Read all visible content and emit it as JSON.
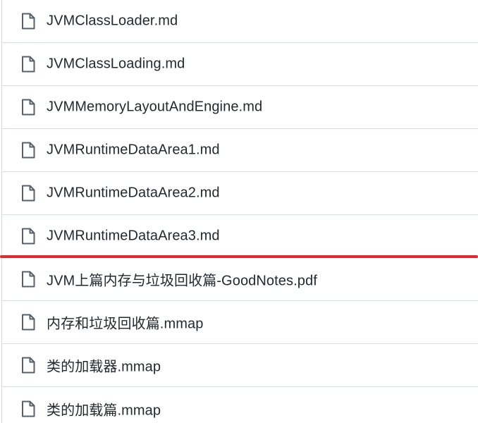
{
  "files": [
    {
      "name": "JVMClassLoader.md",
      "icon": "file-icon"
    },
    {
      "name": "JVMClassLoading.md",
      "icon": "file-icon"
    },
    {
      "name": "JVMMemoryLayoutAndEngine.md",
      "icon": "file-icon"
    },
    {
      "name": "JVMRuntimeDataArea1.md",
      "icon": "file-icon"
    },
    {
      "name": "JVMRuntimeDataArea2.md",
      "icon": "file-icon"
    },
    {
      "name": "JVMRuntimeDataArea3.md",
      "icon": "file-icon"
    },
    {
      "name": "JVM上篇内存与垃圾回收篇-GoodNotes.pdf",
      "icon": "file-icon"
    },
    {
      "name": "内存和垃圾回收篇.mmap",
      "icon": "file-icon"
    },
    {
      "name": "类的加载器.mmap",
      "icon": "file-icon"
    },
    {
      "name": "类的加载篇.mmap",
      "icon": "file-icon"
    }
  ],
  "colors": {
    "text": "#24292f",
    "icon": "#57606a",
    "divider": "#d8dee4",
    "highlight_line": "#e02a2f"
  }
}
